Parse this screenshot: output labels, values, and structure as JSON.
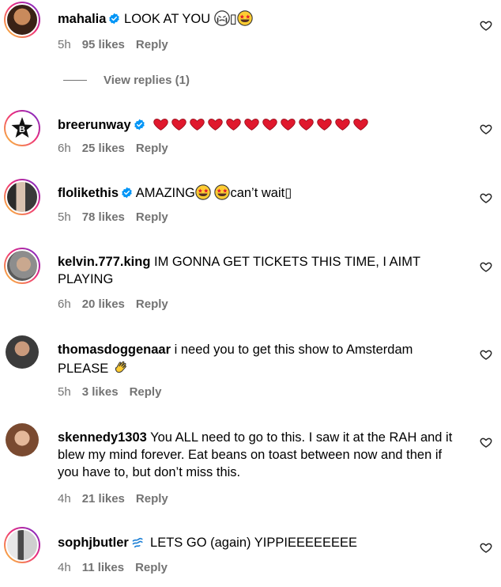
{
  "comments": [
    {
      "username": "mahalia",
      "verified": true,
      "text": " LOOK AT YOU ",
      "time": "5h",
      "likes": "95 likes",
      "reply": "Reply"
    },
    {
      "username": "breerunway",
      "verified": true,
      "text": "",
      "time": "6h",
      "likes": "25 likes",
      "reply": "Reply"
    },
    {
      "username": "flolikethis",
      "verified": true,
      "text": " AMAZING",
      "text2": "can’t wait",
      "time": "5h",
      "likes": "78 likes",
      "reply": "Reply"
    },
    {
      "username": "kelvin.777.king",
      "verified": false,
      "text": " IM GONNA GET TICKETS THIS TIME, I AIMT PLAYING",
      "time": "6h",
      "likes": "20 likes",
      "reply": "Reply"
    },
    {
      "username": "thomasdoggenaar",
      "verified": false,
      "text": " i need you to get this show to Amsterdam PLEASE ",
      "time": "5h",
      "likes": "3 likes",
      "reply": "Reply"
    },
    {
      "username": "skennedy1303",
      "verified": false,
      "text": " You ALL need to go to this. I saw it at the RAH and it blew my mind forever. Eat beans on toast between now and then if you have to, but don’t miss this.",
      "time": "4h",
      "likes": "21 likes",
      "reply": "Reply"
    },
    {
      "username": "sophjbutler",
      "verified": false,
      "text": " LETS GO (again) YIPPIEEEEEEEE",
      "time": "4h",
      "likes": "11 likes",
      "reply": "Reply"
    }
  ],
  "view_replies": "View replies (1)",
  "icons": {
    "like": "heart-outline-icon",
    "verified": "verified-badge-icon"
  },
  "colors": {
    "meta": "#737373",
    "verified": "#0095f6",
    "heart": "#e0182d"
  }
}
